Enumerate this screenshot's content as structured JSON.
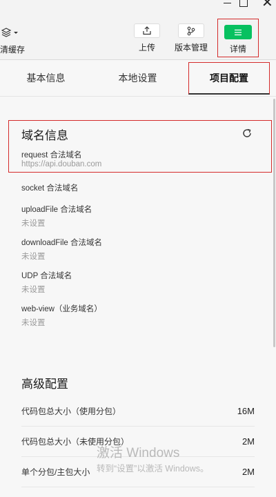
{
  "toolbar": {
    "clear_cache_label": "清缓存",
    "upload_label": "上传",
    "version_label": "版本管理",
    "detail_label": "详情"
  },
  "tabs": [
    {
      "label": "基本信息"
    },
    {
      "label": "本地设置"
    },
    {
      "label": "项目配置"
    }
  ],
  "domain_info": {
    "title": "域名信息",
    "request": {
      "label": "request 合法域名",
      "value": "https://api.douban.com"
    },
    "socket": {
      "label": "socket 合法域名",
      "value": ""
    },
    "uploadFile": {
      "label": "uploadFile 合法域名",
      "value": "未设置"
    },
    "downloadFile": {
      "label": "downloadFile 合法域名",
      "value": "未设置"
    },
    "udp": {
      "label": "UDP 合法域名",
      "value": "未设置"
    },
    "webview": {
      "label": "web-view（业务域名）",
      "value": "未设置"
    }
  },
  "advanced": {
    "title": "高级配置",
    "rows": [
      {
        "label": "代码包总大小（使用分包）",
        "value": "16M"
      },
      {
        "label": "代码包总大小（未使用分包）",
        "value": "2M"
      },
      {
        "label": "单个分包/主包大小",
        "value": "2M"
      }
    ]
  },
  "watermark": {
    "line1": "激活 Windows",
    "line2": "转到“设置”以激活 Windows。"
  },
  "colors": {
    "accent_green": "#07c160",
    "highlight_red": "#d42a2a"
  }
}
